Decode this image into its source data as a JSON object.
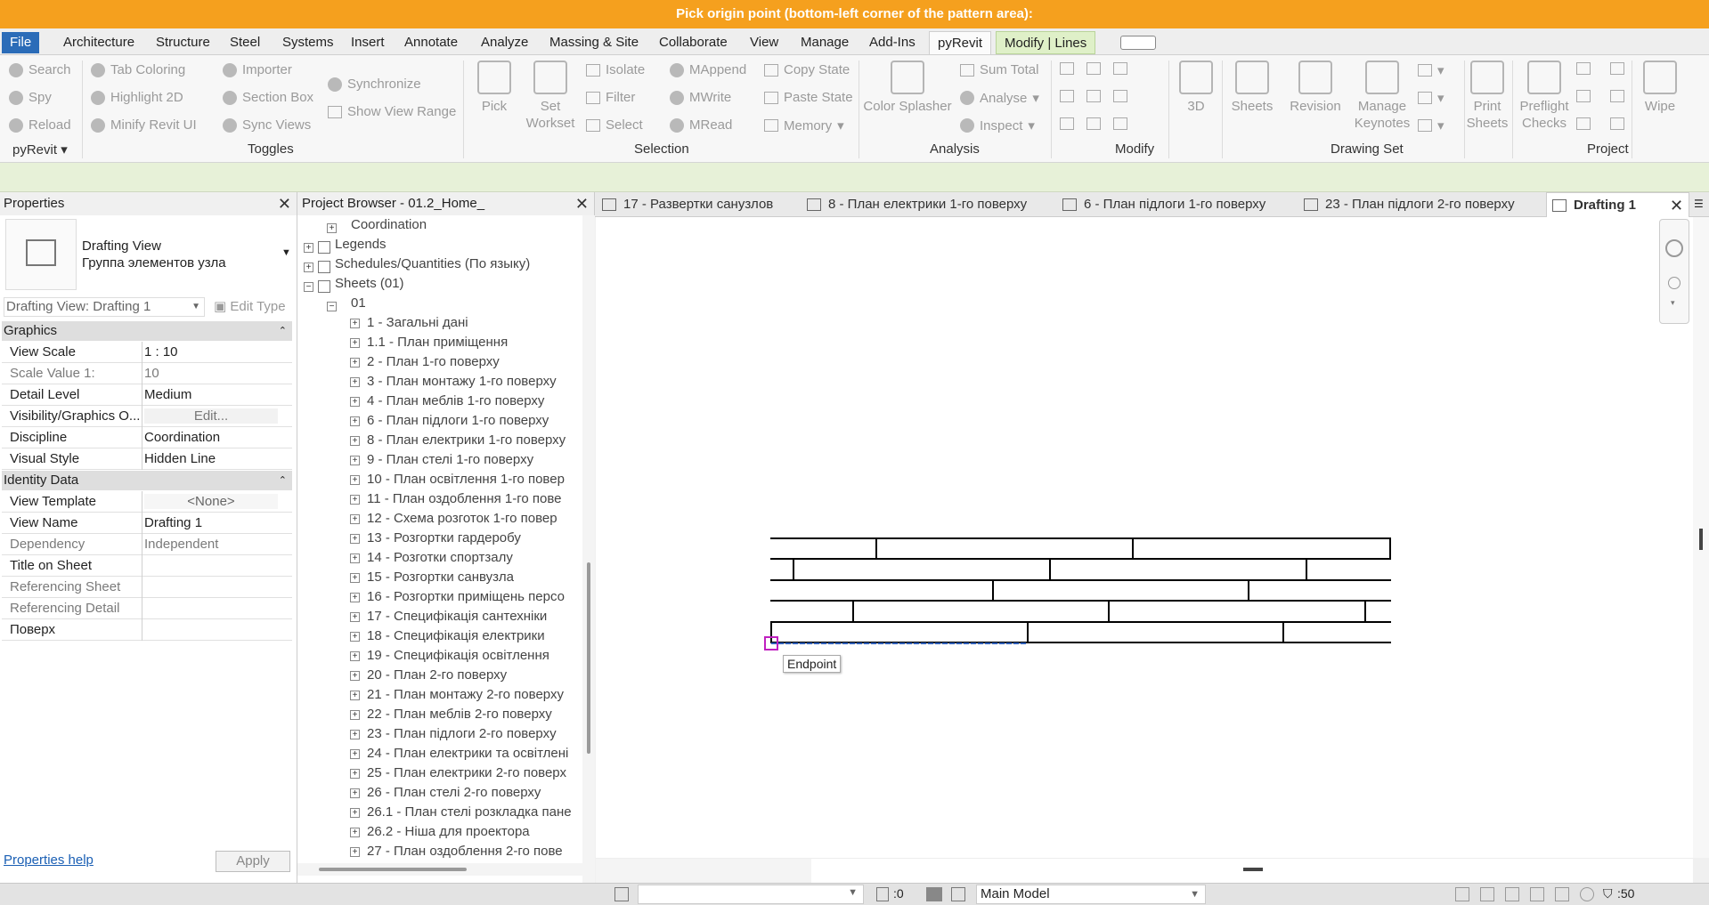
{
  "title_bar": {
    "prompt": "Pick origin point (bottom-left corner of the pattern area):"
  },
  "ribbon_tabs": [
    "File",
    "Architecture",
    "Structure",
    "Steel",
    "Systems",
    "Insert",
    "Annotate",
    "Analyze",
    "Massing & Site",
    "Collaborate",
    "View",
    "Manage",
    "Add-Ins",
    "pyRevit",
    "Modify | Lines"
  ],
  "ribbon": {
    "pyrevit_small": {
      "search": "Search",
      "spy": "Spy",
      "reload": "Reload",
      "dropdown": "pyRevit"
    },
    "toggles": {
      "tab_coloring": "Tab Coloring",
      "highlight_2d": "Highlight 2D",
      "minify": "Minify Revit UI",
      "importer": "Importer",
      "section_box": "Section Box",
      "sync_views": "Sync Views",
      "synchronize": "Synchronize",
      "show_view_range": "Show View Range",
      "group": "Toggles"
    },
    "selection": {
      "pick": "Pick",
      "set_workset_1": "Set",
      "set_workset_2": "Workset",
      "isolate": "Isolate",
      "filter": "Filter",
      "select": "Select",
      "mappend": "MAppend",
      "mwrite": "MWrite",
      "mread": "MRead",
      "copy_state": "Copy State",
      "paste_state": "Paste State",
      "memory": "Memory",
      "group": "Selection"
    },
    "analysis": {
      "color_splasher": "Color Splasher",
      "sum_total": "Sum Total",
      "analyse": "Analyse",
      "inspect": "Inspect",
      "group": "Analysis"
    },
    "modify": {
      "group": "Modify"
    },
    "drawing_set": {
      "three_d": "3D",
      "sheets": "Sheets",
      "revision": "Revision",
      "manage_1": "Manage",
      "manage_2": "Keynotes",
      "group": "Drawing Set"
    },
    "project": {
      "print_1": "Print",
      "print_2": "Sheets",
      "preflight_1": "Preflight",
      "preflight_2": "Checks",
      "wipe": "Wipe",
      "group": "Project"
    }
  },
  "properties": {
    "header": "Properties",
    "type_name": "Drafting View",
    "type_sub": "Группа элементов узла",
    "instance_selector": "Drafting View: Drafting 1",
    "edit_type": "Edit Type",
    "graphics": "Graphics",
    "rows_graphics": [
      {
        "k": "View Scale",
        "v": "1 : 10"
      },
      {
        "k": "Scale Value    1:",
        "v": "10"
      },
      {
        "k": "Detail Level",
        "v": "Medium"
      },
      {
        "k": "Visibility/Graphics O...",
        "v": "Edit..."
      },
      {
        "k": "Discipline",
        "v": "Coordination"
      },
      {
        "k": "Visual Style",
        "v": "Hidden Line"
      }
    ],
    "identity": "Identity Data",
    "rows_identity": [
      {
        "k": "View Template",
        "v": "<None>"
      },
      {
        "k": "View Name",
        "v": "Drafting 1"
      },
      {
        "k": "Dependency",
        "v": "Independent"
      },
      {
        "k": "Title on Sheet",
        "v": ""
      },
      {
        "k": "Referencing Sheet",
        "v": ""
      },
      {
        "k": "Referencing Detail",
        "v": ""
      },
      {
        "k": "Поверх",
        "v": ""
      }
    ],
    "help": "Properties help",
    "apply": "Apply"
  },
  "browser": {
    "header": "Project Browser - 01.2_Home_",
    "top": [
      {
        "t": "Coordination"
      },
      {
        "t": "Legends"
      },
      {
        "t": "Schedules/Quantities (По языку)"
      },
      {
        "t": "Sheets (01)"
      },
      {
        "t": "01"
      }
    ],
    "sheets": [
      "1 - Загальні дані",
      "1.1 - План приміщення",
      "2 - План 1-го поверху",
      "3 - План монтажу 1-го поверху",
      "4 - План меблів 1-го поверху",
      "6 - План підлоги 1-го поверху",
      "8 - План електрики 1-го поверху",
      "9 - План стелі 1-го поверху",
      "10 - План освітлення 1-го повер",
      "11 - План оздоблення 1-го пове",
      "12 - Схема розготок 1-го повер",
      "13 - Розгортки гардеробу",
      "14 - Розготки спортзалу",
      "15 - Розгортки санвузла",
      "16 - Розгортки приміщень персо",
      "17 - Специфікація сантехніки",
      "18 - Специфікація електрики",
      "19 - Специфікація освітлення",
      "20 - План 2-го поверху",
      "21 - План монтажу 2-го поверху",
      "22 - План меблів 2-го поверху",
      "23 - План підлоги 2-го поверху",
      "24 - План електрики та освітлені",
      "25 - План електрики 2-го поверх",
      "26 - План стелі 2-го поверху",
      "26.1 - План стелі розкладка пане",
      "26.2 - Ніша для проектора",
      "27 - План оздоблення 2-го пове"
    ]
  },
  "view_tabs": [
    "17 - Развертки санузлов",
    "8 - План електрики 1-го поверху",
    "6 - План підлоги 1-го поверху",
    "23 - План підлоги 2-го поверху",
    "Drafting 1"
  ],
  "canvas": {
    "tooltip": "Endpoint"
  },
  "status": {
    "worksets_count": ":0",
    "model": "Main Model",
    "filter_count": ":50"
  }
}
